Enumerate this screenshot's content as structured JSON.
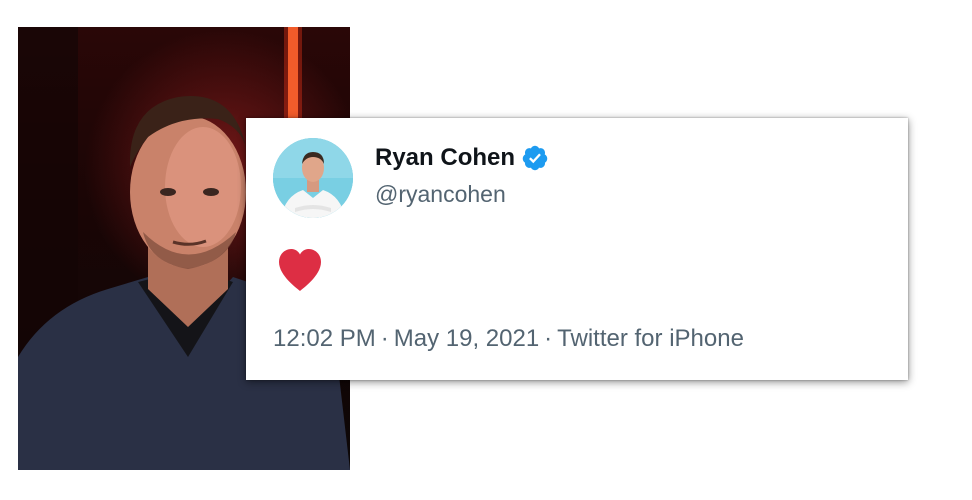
{
  "tweet": {
    "display_name": "Ryan Cohen",
    "handle": "@ryancohen",
    "verified": true,
    "body_emoji": "heart-icon",
    "time": "12:02 PM",
    "separator": "·",
    "date": "May 19, 2021",
    "source": "Twitter for iPhone"
  },
  "colors": {
    "verified_blue": "#1d9bf0",
    "heart_red": "#e0245e",
    "meta_gray": "#536471",
    "name_black": "#0f1419"
  }
}
